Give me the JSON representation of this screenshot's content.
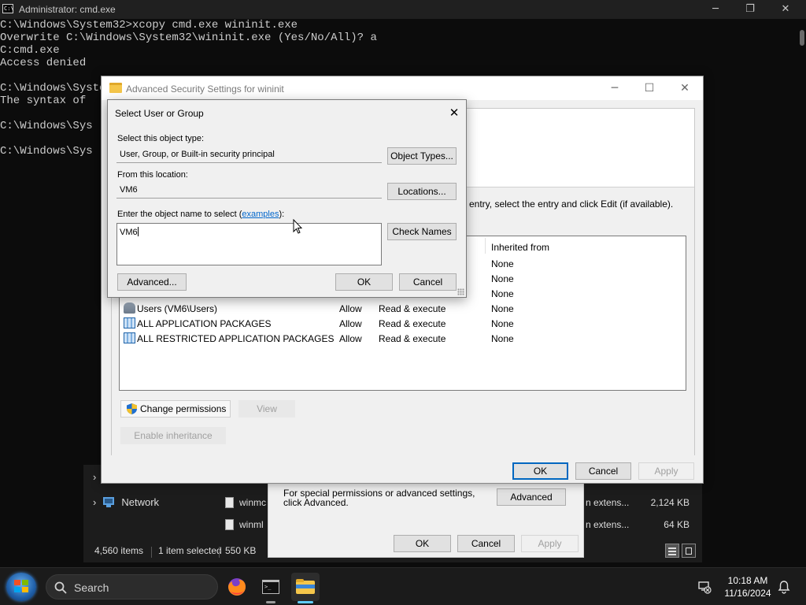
{
  "cmd": {
    "title": "Administrator: cmd.exe",
    "icon_text": "C:\\",
    "lines": [
      "C:\\Windows\\System32>xcopy cmd.exe wininit.exe",
      "Overwrite C:\\Windows\\System32\\wininit.exe (Yes/No/All)? a",
      "C:cmd.exe",
      "Access denied",
      "",
      "C:\\Windows\\Syste",
      "The syntax of",
      "",
      "C:\\Windows\\Sys",
      "",
      "C:\\Windows\\Sys"
    ],
    "controls": {
      "minimize": "─",
      "maximize": "❐",
      "close": "✕"
    }
  },
  "explorer": {
    "nav_chevron": "›",
    "network_label": "Network",
    "files": [
      {
        "name": "winmc",
        "type": "n extens...",
        "size": "2,124 KB"
      },
      {
        "name": "winml",
        "type": "n extens...",
        "size": "64 KB"
      }
    ],
    "status": {
      "items": "4,560 items",
      "selected": "1 item selected",
      "size": "550 KB"
    }
  },
  "properties": {
    "advanced_text": "For special permissions or advanced settings, click Advanced.",
    "advanced_button": "Advanced",
    "ok": "OK",
    "cancel": "Cancel",
    "apply": "Apply"
  },
  "advanced_security": {
    "title": "Advanced Security Settings for wininit",
    "controls": {
      "minimize": "─",
      "maximize": "☐",
      "close": "✕"
    },
    "hint": "entry, select the entry and click Edit (if available).",
    "column_inherited_from": "Inherited from",
    "entries": [
      {
        "icon": "none",
        "name": "",
        "type": "",
        "access": "",
        "inherited": "None"
      },
      {
        "icon": "none",
        "name": "",
        "type": "",
        "access": "",
        "inherited": "None"
      },
      {
        "icon": "none",
        "name": "",
        "type": "",
        "access": "",
        "inherited": "None"
      },
      {
        "icon": "users-icon",
        "name": "Users (VM6\\Users)",
        "type": "Allow",
        "access": "Read & execute",
        "inherited": "None"
      },
      {
        "icon": "package-icon",
        "name": "ALL APPLICATION PACKAGES",
        "type": "Allow",
        "access": "Read & execute",
        "inherited": "None"
      },
      {
        "icon": "package-icon",
        "name": "ALL RESTRICTED APPLICATION PACKAGES",
        "type": "Allow",
        "access": "Read & execute",
        "inherited": "None"
      }
    ],
    "change_permissions": "Change permissions",
    "view": "View",
    "enable_inheritance": "Enable inheritance",
    "ok": "OK",
    "cancel": "Cancel",
    "apply": "Apply"
  },
  "select_user": {
    "title": "Select User or Group",
    "close": "✕",
    "object_type_label": "Select this object type:",
    "object_type_value": "User, Group, or Built-in security principal",
    "object_types_button": "Object Types...",
    "location_label": "From this location:",
    "location_value": "VM6",
    "locations_button": "Locations...",
    "name_label_prefix": "Enter the object name to select (",
    "name_label_link": "examples",
    "name_label_suffix": "):",
    "name_value": "VM6",
    "check_names_button": "Check Names",
    "advanced_button": "Advanced...",
    "ok": "OK",
    "cancel": "Cancel"
  },
  "taskbar": {
    "search_placeholder": "Search",
    "time": "10:18 AM",
    "date": "11/16/2024",
    "apps": [
      "firefox-icon",
      "terminal-icon",
      "file-explorer-icon"
    ]
  },
  "colors": {
    "accent": "#0067c0",
    "taskbar_indicator_active": "#60cdff",
    "link": "#0066cc"
  }
}
